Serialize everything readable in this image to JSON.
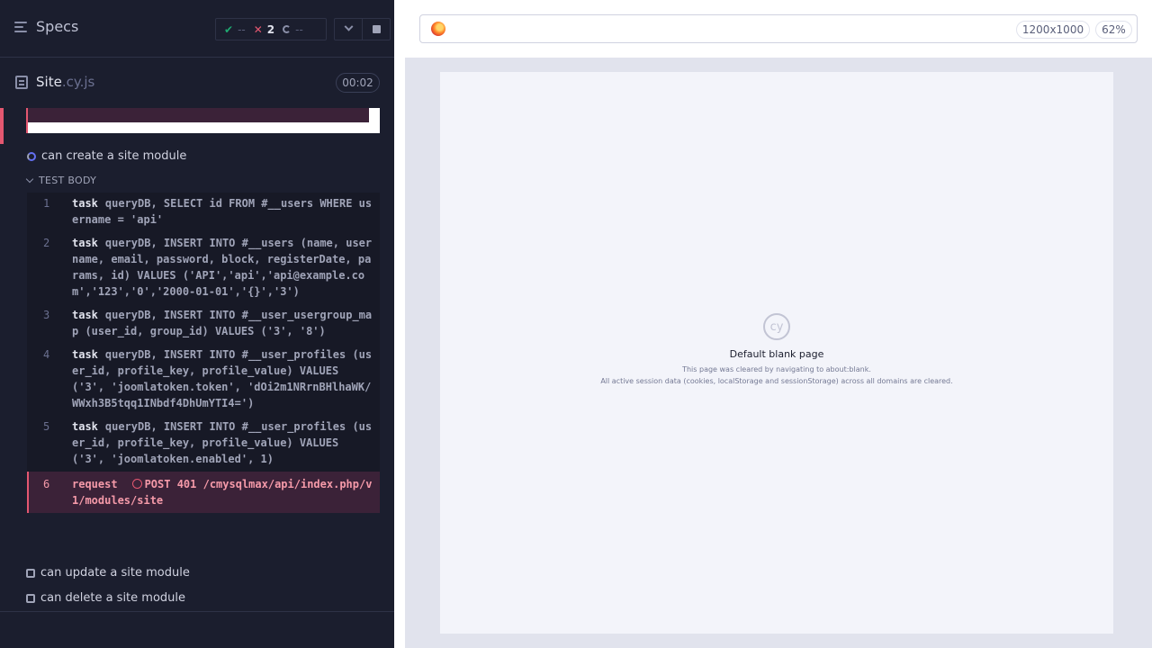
{
  "reporter": {
    "header": {
      "specs_label": "Specs",
      "stats": {
        "passed": "--",
        "failed": "2",
        "pending": "--"
      }
    },
    "spec": {
      "name": "Site",
      "ext": ".cy.js",
      "duration": "00:02"
    },
    "current_test": "can create a site module",
    "test_body_label": "TEST BODY",
    "commands": [
      {
        "num": "1",
        "name": "task",
        "message": "queryDB, SELECT id FROM #__users WHERE username = 'api'"
      },
      {
        "num": "2",
        "name": "task",
        "message": "queryDB, INSERT INTO #__users (name, username, email, password, block, registerDate, params, id) VALUES ('API','api','api@example.com','123','0','2000-01-01','{}','3')"
      },
      {
        "num": "3",
        "name": "task",
        "message": "queryDB, INSERT INTO #__user_usergroup_map (user_id, group_id) VALUES ('3', '8')"
      },
      {
        "num": "4",
        "name": "task",
        "message": "queryDB, INSERT INTO #__user_profiles (user_id, profile_key, profile_value) VALUES ('3', 'joomlatoken.token', 'dOi2m1NRrnBHlhaWK/WWxh3B5tqq1INbdf4DhUmYTI4=')"
      },
      {
        "num": "5",
        "name": "task",
        "message": "queryDB, INSERT INTO #__user_profiles (user_id, profile_key, profile_value) VALUES ('3', 'joomlatoken.enabled', 1)"
      },
      {
        "num": "6",
        "name": "request",
        "message": "POST 401 /cmysqlmax/api/index.php/v1/modules/site"
      }
    ],
    "other_tests": [
      "can update a site module",
      "can delete a site module"
    ]
  },
  "preview": {
    "viewport_size": "1200x1000",
    "zoom": "62%",
    "blank_logo": "cy",
    "blank_title": "Default blank page",
    "blank_line1": "This page was cleared by navigating to about:blank.",
    "blank_line2": "All active session data (cookies, localStorage and sessionStorage) across all domains are cleared."
  },
  "colors": {
    "reporter_bg": "#1b1e2e",
    "pass": "#1fa971",
    "fail": "#e45770",
    "running": "#6470f3"
  }
}
